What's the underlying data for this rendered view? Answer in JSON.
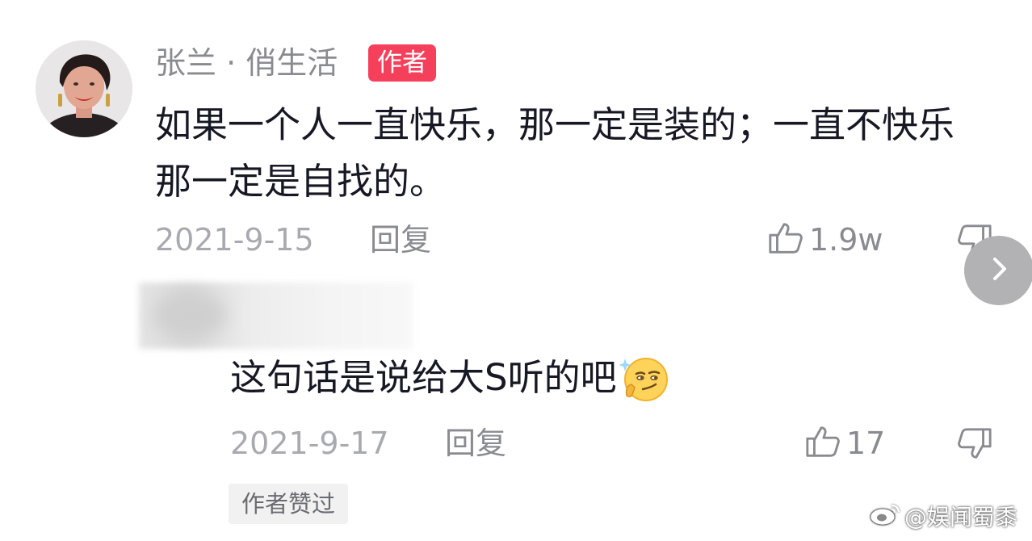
{
  "comment": {
    "author": "张兰 · 俏生活",
    "author_badge": "作者",
    "text": "如果一个人一直快乐，那一定是装的；一直不快乐那一定是自找的。",
    "date": "2021-9-15",
    "reply_label": "回复",
    "likes": "1.9w"
  },
  "reply": {
    "text": "这句话是说给大S听的吧",
    "emoji": "smirk-emoji",
    "date": "2021-9-17",
    "reply_label": "回复",
    "likes": "17",
    "liked_by_author": "作者赞过"
  },
  "watermark": {
    "text": "@娱闻蜀黍",
    "icon": "weibo-icon"
  },
  "colors": {
    "badge": "#f5405c",
    "meta": "#a9aab0",
    "text": "#161823"
  }
}
